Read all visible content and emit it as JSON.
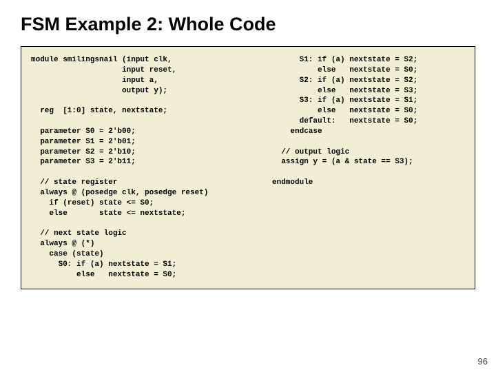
{
  "title": "FSM Example 2: Whole Code",
  "pageNumber": "96",
  "code": {
    "left": "module smilingsnail (input clk, \n                    input reset, \n                    input a, \n                    output y);\n\n  reg  [1:0] state, nextstate;\n\n  parameter S0 = 2'b00;\n  parameter S1 = 2'b01;\n  parameter S2 = 2'b10;\n  parameter S3 = 2'b11;\n\n  // state register\n  always @ (posedge clk, posedge reset)\n    if (reset) state <= S0;\n    else       state <= nextstate;\n\n  // next state logic\n  always @ (*)\n    case (state)\n      S0: if (a) nextstate = S1;\n          else   nextstate = S0;",
    "right": "      S1: if (a) nextstate = S2;\n          else   nextstate = S0;\n      S2: if (a) nextstate = S2;\n          else   nextstate = S3;\n      S3: if (a) nextstate = S1;\n          else   nextstate = S0;\n      default:   nextstate = S0;\n    endcase\n\n  // output logic\n  assign y = (a & state == S3);\n\nendmodule"
  }
}
